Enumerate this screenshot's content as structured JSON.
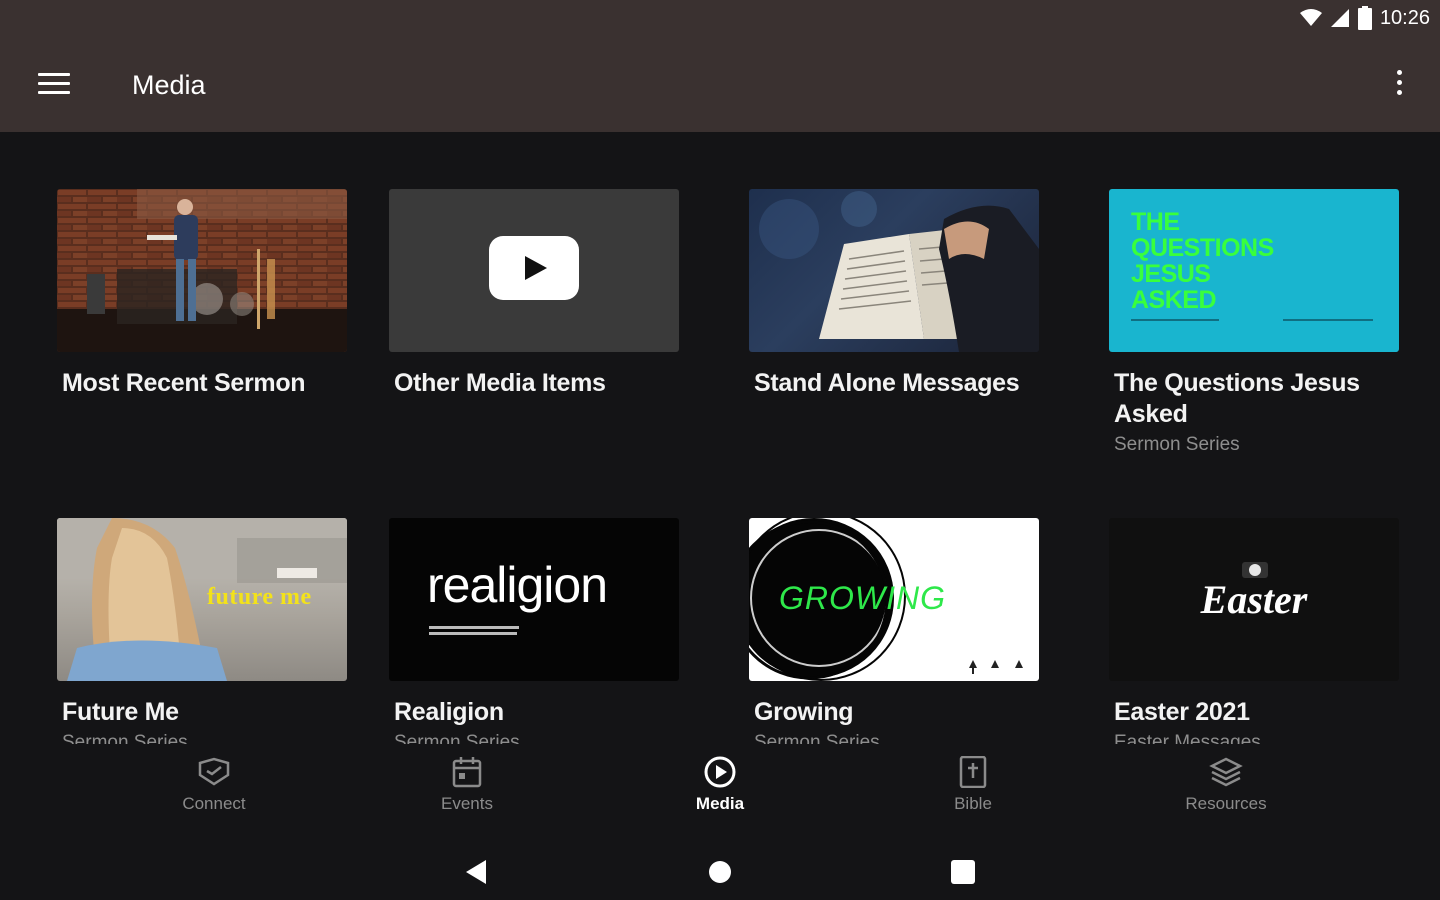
{
  "status_bar": {
    "time": "10:26"
  },
  "app_bar": {
    "title": "Media"
  },
  "tiles": [
    {
      "title": "Most Recent Sermon",
      "subtitle": ""
    },
    {
      "title": "Other Media Items",
      "subtitle": ""
    },
    {
      "title": "Stand Alone Messages",
      "subtitle": ""
    },
    {
      "title": "The Questions Jesus Asked",
      "subtitle": "Sermon Series",
      "thumb_text": [
        "THE",
        "QUESTIONS",
        "JESUS",
        "ASKED"
      ]
    },
    {
      "title": "Future Me",
      "subtitle": "Sermon Series",
      "thumb_text": "future me"
    },
    {
      "title": "Realigion",
      "subtitle": "Sermon Series",
      "thumb_text": "realigion"
    },
    {
      "title": "Growing",
      "subtitle": "Sermon Series",
      "thumb_text": "GROWING"
    },
    {
      "title": "Easter 2021",
      "subtitle": "Easter Messages",
      "thumb_text": "Easter"
    }
  ],
  "bottom_nav": [
    {
      "label": "Connect",
      "icon": "connect-icon",
      "active": false
    },
    {
      "label": "Events",
      "icon": "calendar-icon",
      "active": false
    },
    {
      "label": "Media",
      "icon": "play-circle-icon",
      "active": true
    },
    {
      "label": "Bible",
      "icon": "bible-icon",
      "active": false
    },
    {
      "label": "Resources",
      "icon": "layers-icon",
      "active": false
    }
  ],
  "colors": {
    "app_bar": "#3a3130",
    "background": "#141416",
    "qja_teal": "#19b5cf",
    "qja_green": "#39ff3c",
    "growing_green": "#2ee84a",
    "future_yellow": "#f3e21a"
  }
}
